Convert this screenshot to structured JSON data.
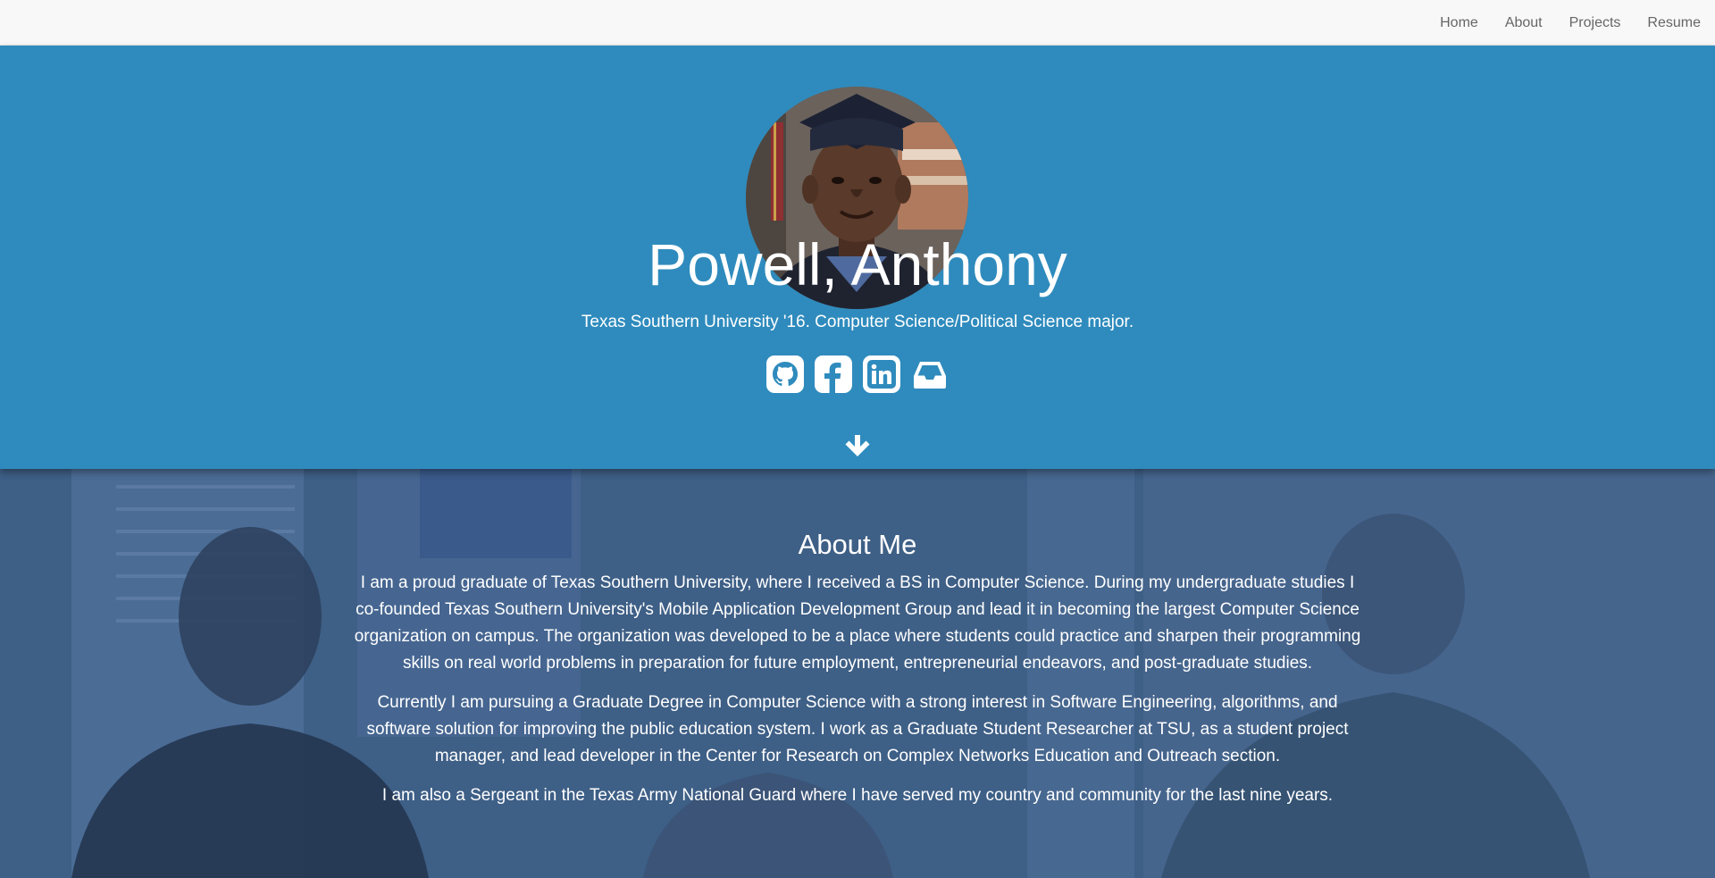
{
  "nav": {
    "items": [
      {
        "label": "Home"
      },
      {
        "label": "About"
      },
      {
        "label": "Projects"
      },
      {
        "label": "Resume"
      }
    ]
  },
  "hero": {
    "name": "Powell, Anthony",
    "tagline": "Texas Southern University '16. Computer Science/Political Science major.",
    "social": [
      {
        "icon": "github-icon"
      },
      {
        "icon": "facebook-icon"
      },
      {
        "icon": "linkedin-icon"
      },
      {
        "icon": "inbox-icon"
      }
    ],
    "scroll_icon": "arrow-down-icon"
  },
  "about": {
    "title": "About Me",
    "paragraphs": [
      "I am a proud graduate of Texas Southern University, where I received a BS in Computer Science. During my undergraduate studies I co-founded Texas Southern University's Mobile Application Development Group and lead it in becoming the largest Computer Science organization on campus. The organization was developed to be a place where students could practice and sharpen their programming skills on real world problems in preparation for future employment, entrepreneurial endeavors, and post-graduate studies.",
      "Currently I am pursuing a Graduate Degree in Computer Science with a strong interest in Software Engineering, algorithms, and software solution for improving the public education system. I work as a Graduate Student Researcher at TSU, as a student project manager, and lead developer in the Center for Research on Complex Networks Education and Outreach section.",
      "I am also a Sergeant in the Texas Army National Guard where I have served my country and community for the last nine years."
    ]
  },
  "colors": {
    "navbar_bg": "#f8f8f8",
    "nav_text": "#666666",
    "hero_bg": "#2f8bbd",
    "about_overlay": "#3f6288",
    "text_light": "#ffffff"
  }
}
